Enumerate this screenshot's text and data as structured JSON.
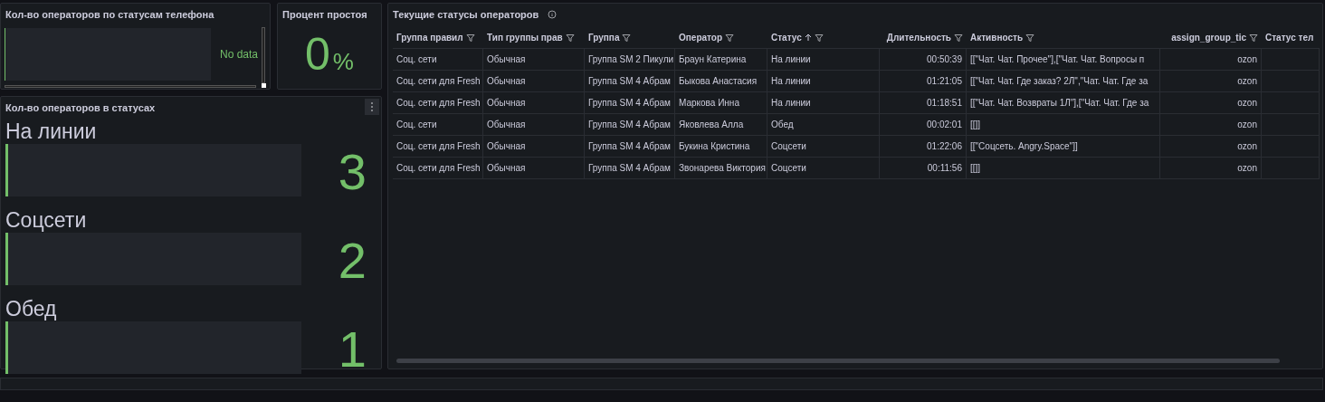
{
  "phone_panel": {
    "title": "Кол-во операторов по статусам телефона",
    "message": "No data"
  },
  "idle_panel": {
    "title": "Процент простоя",
    "value": "0",
    "unit": "%"
  },
  "status_panel": {
    "title": "Кол-во операторов в статусах",
    "items": [
      {
        "label": "На линии",
        "value": "3"
      },
      {
        "label": "Соцсети",
        "value": "2"
      },
      {
        "label": "Обед",
        "value": "1"
      }
    ]
  },
  "table": {
    "title": "Текущие статусы операторов",
    "columns": [
      {
        "label": "Группа правил",
        "sorted": false,
        "filter_icon": true
      },
      {
        "label": "Тип группы прав",
        "sorted": false,
        "filter_icon": true
      },
      {
        "label": "Группа",
        "sorted": false,
        "filter_icon": true
      },
      {
        "label": "Оператор",
        "sorted": false,
        "filter_icon": true
      },
      {
        "label": "Статус",
        "sorted": true,
        "filter_icon": true
      },
      {
        "label": "Длительность",
        "sorted": false,
        "filter_icon": true
      },
      {
        "label": "Активность",
        "sorted": false,
        "filter_icon": true
      },
      {
        "label": "assign_group_tic",
        "sorted": false,
        "filter_icon": true
      },
      {
        "label": "Статус тел"
      }
    ],
    "rows": [
      [
        "Соц. сети",
        "Обычная",
        "Группа SM 2 Пикули",
        "Браун Катерина",
        "На линии",
        "00:50:39",
        "[[\"Чат. Чат. Прочее\"],[\"Чат. Чат. Вопросы п",
        "ozon"
      ],
      [
        "Соц. сети для Fresh",
        "Обычная",
        "Группа SM 4 Абрам",
        "Быкова Анастасия",
        "На линии",
        "01:21:05",
        "[[\"Чат. Чат. Где заказ? 2Л\",\"Чат. Чат. Где за",
        "ozon"
      ],
      [
        "Соц. сети для Fresh",
        "Обычная",
        "Группа SM 4 Абрам",
        "Маркова Инна",
        "На линии",
        "01:18:51",
        "[[\"Чат. Чат. Возвраты 1Л\"],[\"Чат. Чат. Где за",
        "ozon"
      ],
      [
        "Соц. сети",
        "Обычная",
        "Группа SM 4 Абрам",
        "Яковлева Алла",
        "Обед",
        "00:02:01",
        "[[]]",
        "ozon"
      ],
      [
        "Соц. сети для Fresh",
        "Обычная",
        "Группа SM 4 Абрам",
        "Букина Кристина",
        "Соцсети",
        "01:22:06",
        "[[\"Соцсеть. Angry.Space\"]]",
        "ozon"
      ],
      [
        "Соц. сети для Fresh",
        "Обычная",
        "Группа SM 4 Абрам",
        "Звонарева Виктория",
        "Соцсети",
        "00:11:56",
        "[[]]",
        "ozon"
      ]
    ]
  }
}
